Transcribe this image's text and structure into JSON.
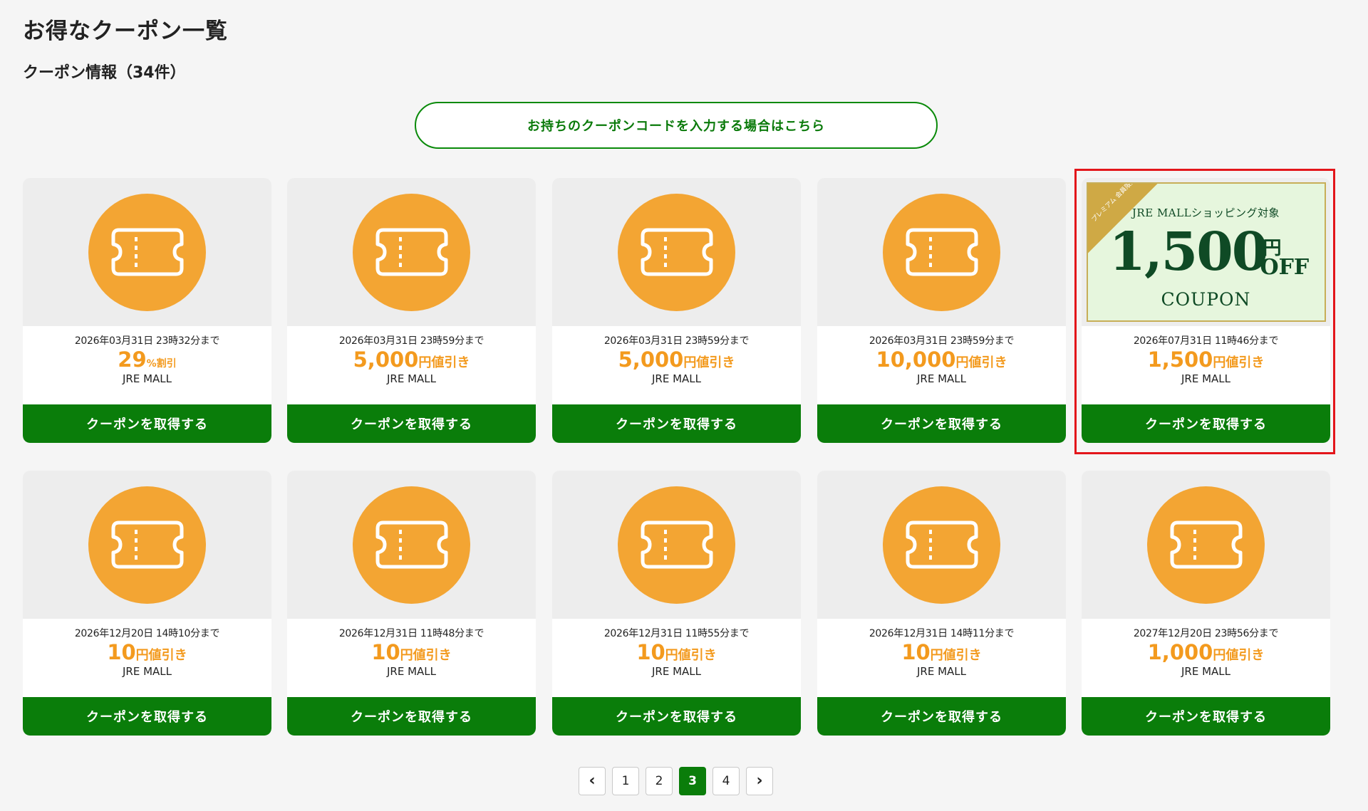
{
  "page": {
    "title": "お得なクーポン一覧",
    "section_title": "クーポン情報（34件）",
    "code_button_label": "お持ちのクーポンコードを入力する場合はこちら"
  },
  "coupons": [
    {
      "expiry": "2026年03月31日 23時32分まで",
      "amount": "29",
      "unit": "%割引",
      "shop": "JRE MALL",
      "button": "クーポンを取得する"
    },
    {
      "expiry": "2026年03月31日 23時59分まで",
      "amount": "5,000",
      "unit": "円値引き",
      "shop": "JRE MALL",
      "button": "クーポンを取得する"
    },
    {
      "expiry": "2026年03月31日 23時59分まで",
      "amount": "5,000",
      "unit": "円値引き",
      "shop": "JRE MALL",
      "button": "クーポンを取得する"
    },
    {
      "expiry": "2026年03月31日 23時59分まで",
      "amount": "10,000",
      "unit": "円値引き",
      "shop": "JRE MALL",
      "button": "クーポンを取得する"
    },
    {
      "expiry": "2026年07月31日 11時46分まで",
      "amount": "1,500",
      "unit": "円値引き",
      "shop": "JRE MALL",
      "button": "クーポンを取得する"
    },
    {
      "expiry": "2026年12月20日 14時10分まで",
      "amount": "10",
      "unit": "円値引き",
      "shop": "JRE MALL",
      "button": "クーポンを取得する"
    },
    {
      "expiry": "2026年12月31日 11時48分まで",
      "amount": "10",
      "unit": "円値引き",
      "shop": "JRE MALL",
      "button": "クーポンを取得する"
    },
    {
      "expiry": "2026年12月31日 11時55分まで",
      "amount": "10",
      "unit": "円値引き",
      "shop": "JRE MALL",
      "button": "クーポンを取得する"
    },
    {
      "expiry": "2026年12月31日 14時11分まで",
      "amount": "10",
      "unit": "円値引き",
      "shop": "JRE MALL",
      "button": "クーポンを取得する"
    },
    {
      "expiry": "2027年12月20日 23時56分まで",
      "amount": "1,000",
      "unit": "円値引き",
      "shop": "JRE MALL",
      "button": "クーポンを取得する"
    }
  ],
  "banner": {
    "ribbon": "プレミアム 会員限定",
    "subtitle": "JRE MALLショッピング対象",
    "amount": "1,500",
    "yen": "円",
    "off": "OFF",
    "coupon": "COUPON"
  },
  "pagination": {
    "prev": "‹",
    "pages": [
      "1",
      "2",
      "3",
      "4"
    ],
    "current": "3",
    "next": "›"
  },
  "colors": {
    "accent_green": "#0a7d0a",
    "coupon_orange": "#f3a533",
    "highlight_red": "#e3161b"
  },
  "icons": {
    "coupon": "ticket-icon",
    "prev": "chevron-left-icon",
    "next": "chevron-right-icon"
  }
}
